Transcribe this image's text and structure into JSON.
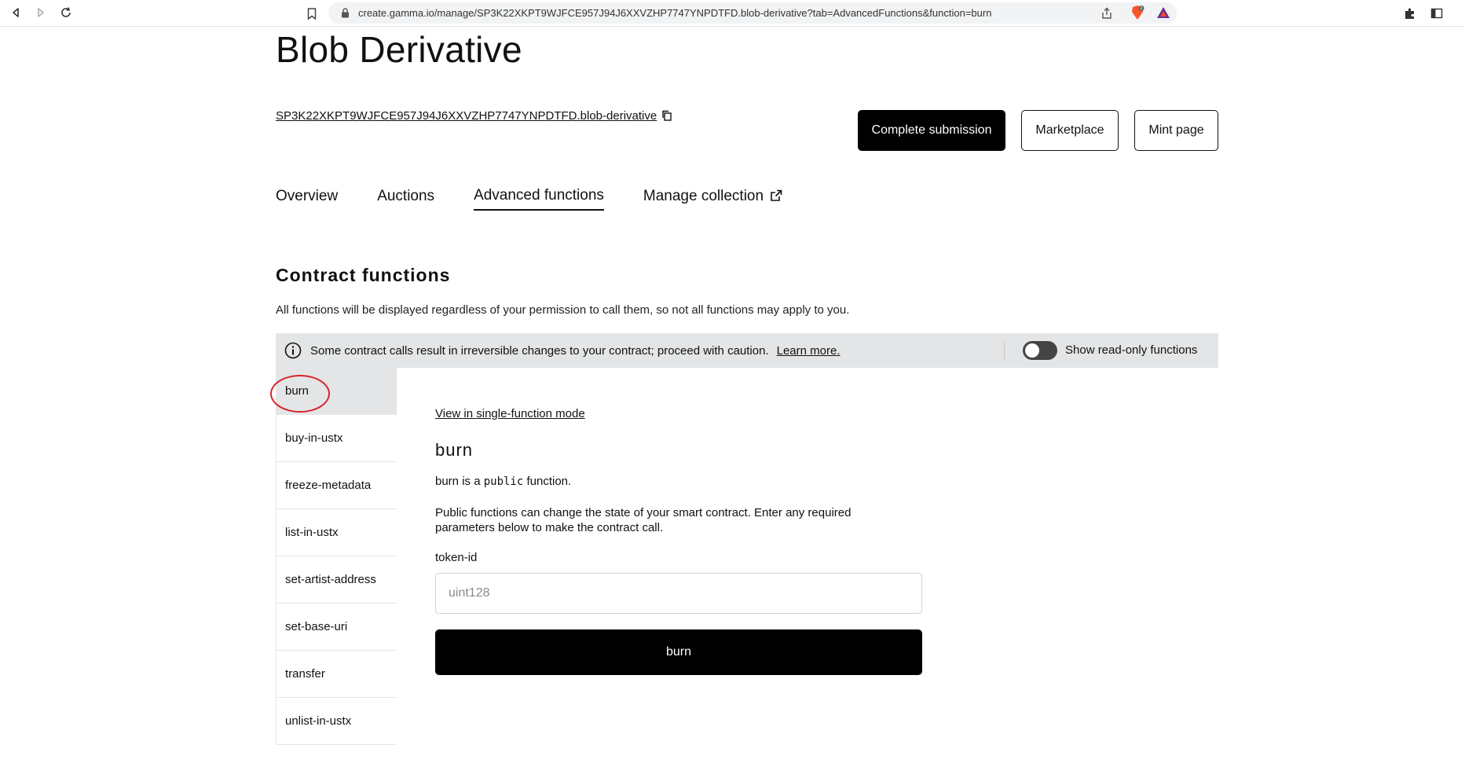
{
  "browser": {
    "url": "create.gamma.io/manage/SP3K22XKPT9WJFCE957J94J6XXVZHP7747YNPDTFD.blob-derivative?tab=AdvancedFunctions&function=burn",
    "brave_badge_count": "2"
  },
  "header": {
    "title": "Blob Derivative",
    "contract_id": "SP3K22XKPT9WJFCE957J94J6XXVZHP7747YNPDTFD.blob-derivative",
    "buttons": {
      "complete_submission": "Complete submission",
      "marketplace": "Marketplace",
      "mint_page": "Mint page"
    }
  },
  "tabs": [
    {
      "label": "Overview",
      "active": false
    },
    {
      "label": "Auctions",
      "active": false
    },
    {
      "label": "Advanced functions",
      "active": true
    },
    {
      "label": "Manage collection",
      "active": false
    }
  ],
  "section": {
    "title": "Contract functions",
    "description": "All functions will be displayed regardless of your permission to call them, so not all functions may apply to you."
  },
  "warning": {
    "text": "Some contract calls result in irreversible changes to your contract; proceed with caution.",
    "learn_more": "Learn more.",
    "toggle_label": "Show read-only functions",
    "toggle_on": false
  },
  "functions": [
    "burn",
    "buy-in-ustx",
    "freeze-metadata",
    "list-in-ustx",
    "set-artist-address",
    "set-base-uri",
    "transfer",
    "unlist-in-ustx"
  ],
  "selected_function": "burn",
  "detail": {
    "single_mode_link": "View in single-function mode",
    "name": "burn",
    "type_prefix": "burn is a",
    "type_code": "public",
    "type_suffix": "function.",
    "note": "Public functions can change the state of your smart contract. Enter any required parameters below to make the contract call.",
    "param_label": "token-id",
    "param_placeholder": "uint128",
    "param_value": "",
    "submit_label": "burn"
  },
  "colors": {
    "accent": "#000000",
    "warning_bg": "#e3e5e6",
    "annotation": "#d8232a"
  }
}
